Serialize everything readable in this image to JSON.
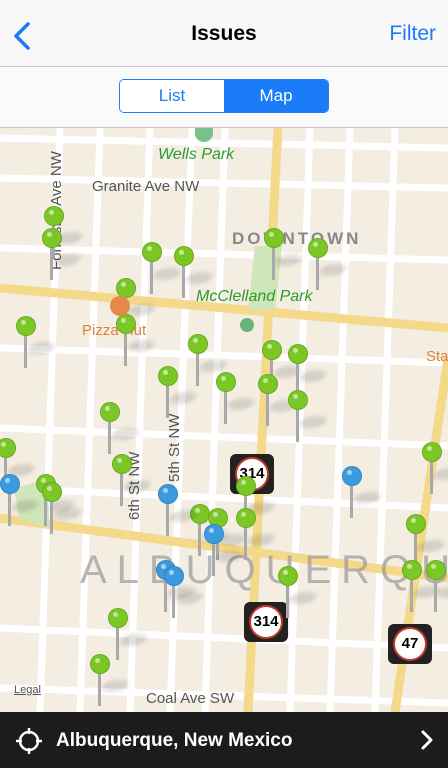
{
  "nav": {
    "title": "Issues",
    "filter_label": "Filter"
  },
  "segment": {
    "list_label": "List",
    "map_label": "Map",
    "selected": "Map"
  },
  "map": {
    "street_labels": [
      "Granite Ave NW",
      "Forrester Ave NW",
      "6th St NW",
      "5th St NW",
      "Coal Ave SW"
    ],
    "park_labels": [
      "Wells Park",
      "McClelland Park"
    ],
    "poi_label": "Pizza Hut",
    "district_label": "DOWNTOWN",
    "city_label": "ALBUQUERQUE",
    "partial_label": "Sta",
    "legal": "Legal",
    "route_shields": [
      "314",
      "314",
      "47"
    ],
    "pin_colors": {
      "green": "#7ac726",
      "blue": "#3b9be0"
    },
    "pins": {
      "green_count": 40,
      "blue_count": 5
    }
  },
  "bottom": {
    "location": "Albuquerque, New Mexico",
    "locate_icon": "location-crosshair-icon",
    "chevron_icon": "chevron-right-icon"
  },
  "colors": {
    "accent": "#1a7cf7",
    "map_bg": "#f3ede2",
    "road": "#f5d98a"
  }
}
